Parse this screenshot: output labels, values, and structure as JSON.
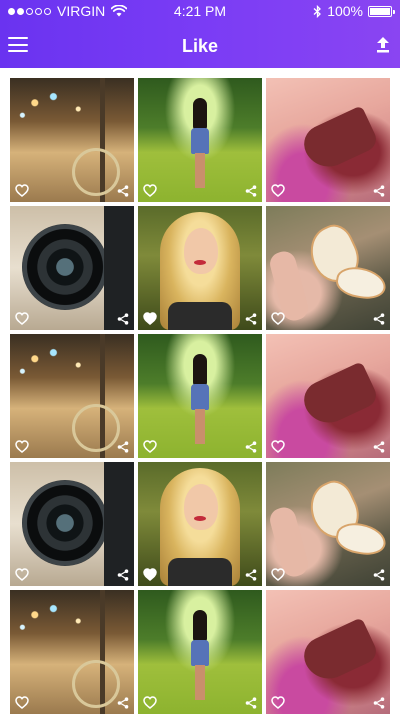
{
  "status_bar": {
    "carrier": "VIRGIN",
    "time": "4:21 PM",
    "battery": "100%",
    "signal_bars_filled": 2,
    "signal_bars_total": 5
  },
  "header": {
    "title": "Like",
    "menu_icon": "hamburger-menu-icon",
    "upload_icon": "upload-icon",
    "color_start": "#6a33f0",
    "color_end": "#8a45f2"
  },
  "grid": {
    "columns": 3,
    "tiles": [
      {
        "photo": "street",
        "liked": false
      },
      {
        "photo": "park",
        "liked": false
      },
      {
        "photo": "henna",
        "liked": false
      },
      {
        "photo": "camera",
        "liked": false
      },
      {
        "photo": "blonde",
        "liked": true
      },
      {
        "photo": "butterfly",
        "liked": false
      },
      {
        "photo": "street",
        "liked": false
      },
      {
        "photo": "park",
        "liked": false
      },
      {
        "photo": "henna",
        "liked": false
      },
      {
        "photo": "camera",
        "liked": false
      },
      {
        "photo": "blonde",
        "liked": true
      },
      {
        "photo": "butterfly",
        "liked": false
      },
      {
        "photo": "street",
        "liked": false
      },
      {
        "photo": "park",
        "liked": false
      },
      {
        "photo": "henna",
        "liked": false
      }
    ]
  }
}
